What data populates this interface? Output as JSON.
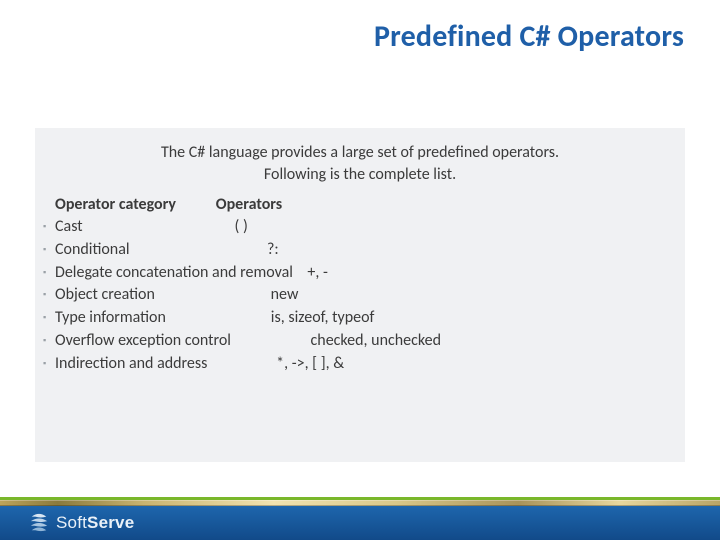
{
  "title": "Predefined C# Operators",
  "intro_line1": "The C# language provides a large set of predefined operators.",
  "intro_line2": "Following is the complete list.",
  "hdr_category": "Operator category",
  "hdr_operators": "Operators",
  "rows": [
    {
      "category": "Cast",
      "operators": "( )"
    },
    {
      "category": "Conditional",
      "operators": "?:"
    },
    {
      "category": "Delegate concatenation and removal",
      "operators": "+, -"
    },
    {
      "category": "Object creation",
      "operators": "new"
    },
    {
      "category": "Type information",
      "operators": "is, sizeof, typeof"
    },
    {
      "category": "Overflow exception control",
      "operators": "checked, unchecked"
    },
    {
      "category": "Indirection and address",
      "operators": "*, ->, [ ], &"
    }
  ],
  "row_lines": [
    "Cast                                          ( )",
    "Conditional                                      ?:",
    "Delegate concatenation and removal    +, -",
    "Object creation                                new",
    "Type information                             is, sizeof, typeof",
    "Overflow exception control                      checked, unchecked",
    "Indirection and address                   *, ->, [ ], &"
  ],
  "brand_soft": "Soft",
  "brand_serve": "Serve"
}
